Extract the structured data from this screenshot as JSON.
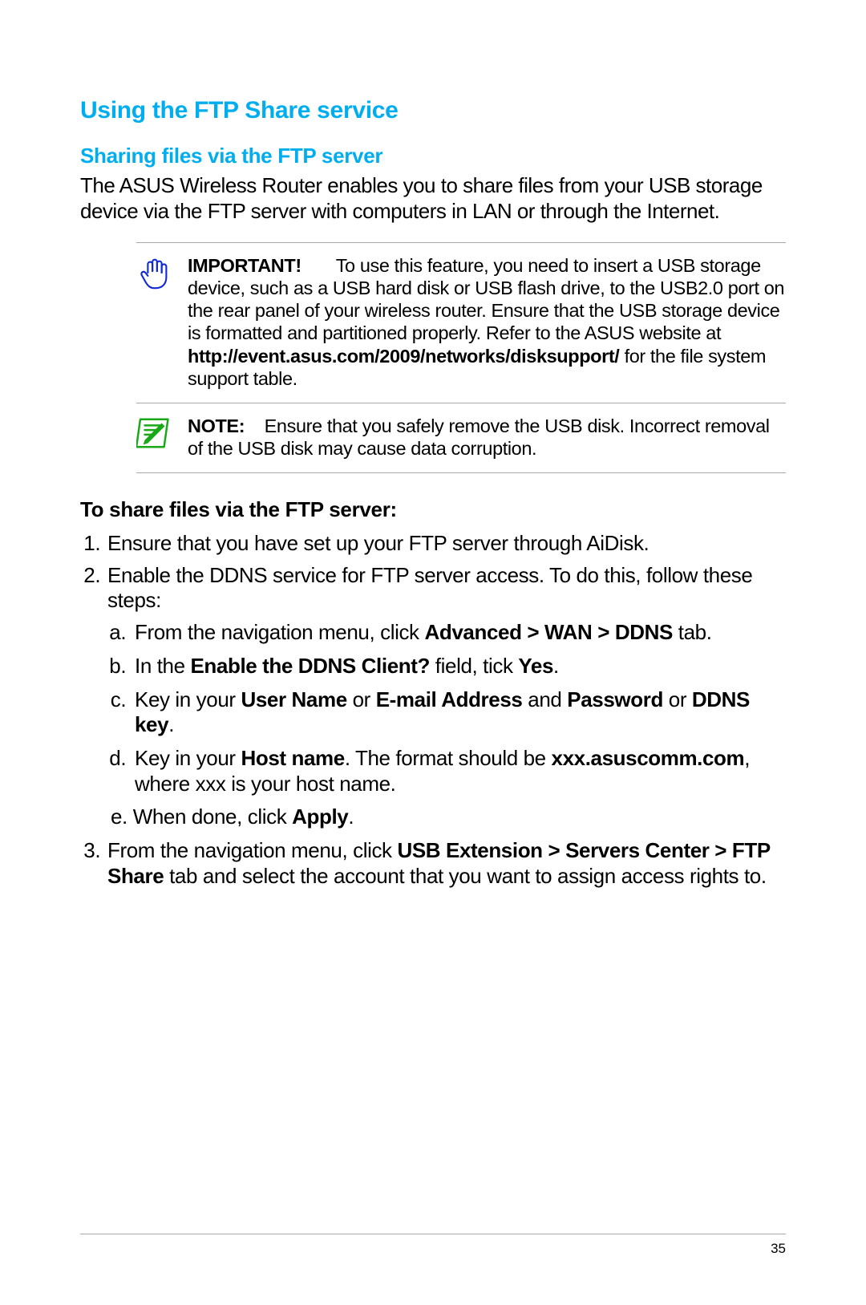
{
  "heading": "Using the FTP Share service",
  "subheading": "Sharing files via the FTP server",
  "intro": "The ASUS Wireless Router enables you to share files from your USB storage device via the FTP server with computers in LAN or through the Internet.",
  "important": {
    "label": "IMPORTANT",
    "text1": "To use this feature, you need to insert a USB storage device, such as a USB hard disk or USB  flash drive, to the USB2.0 port on the rear panel of your wireless router. Ensure that the USB storage device is formatted and partitioned properly. Refer to the ASUS website at",
    "url": "http://event.asus.com/2009/networks/disksupport/",
    "text2": "for the file system support table."
  },
  "note": {
    "label": "NOTE",
    "text": "Ensure that you safely remove the USB disk. Incorrect removal of the USB disk may cause data corruption."
  },
  "instructions_title": "To share files via the FTP server:",
  "steps": {
    "s1": "Ensure that you have set up your FTP server through AiDisk.",
    "s2_intro": "Enable the DDNS service for FTP server access. To do this, follow these steps:",
    "s2a_pre": "From the navigation menu, click ",
    "s2a_nav": "Advanced > WAN > DDNS",
    "s2a_post": " tab.",
    "s2b_pre": "In the ",
    "s2b_field": "Enable the DDNS Client?",
    "s2b_mid": " field, tick ",
    "s2b_yes": "Yes",
    "s2b_post": ".",
    "s2c_pre": "Key in your ",
    "s2c_user": "User Name",
    "s2c_or1": " or ",
    "s2c_email": "E-mail Address",
    "s2c_and": " and ",
    "s2c_pass": "Password",
    "s2c_or2": " or ",
    "s2c_ddns": "DDNS key",
    "s2c_post": ".",
    "s2d_pre": "Key in your ",
    "s2d_host": "Host name",
    "s2d_mid": ". The format should be ",
    "s2d_fmt": "xxx.asuscomm.com",
    "s2d_post": ", where xxx is your host name.",
    "s2e_pre": "When done, click ",
    "s2e_apply": "Apply",
    "s2e_post": ".",
    "s3_pre": "From the navigation menu, click ",
    "s3_nav": "USB Extension > Servers Center > FTP Share",
    "s3_post": " tab and select the account that you want to assign access rights to."
  },
  "page_number": "35"
}
